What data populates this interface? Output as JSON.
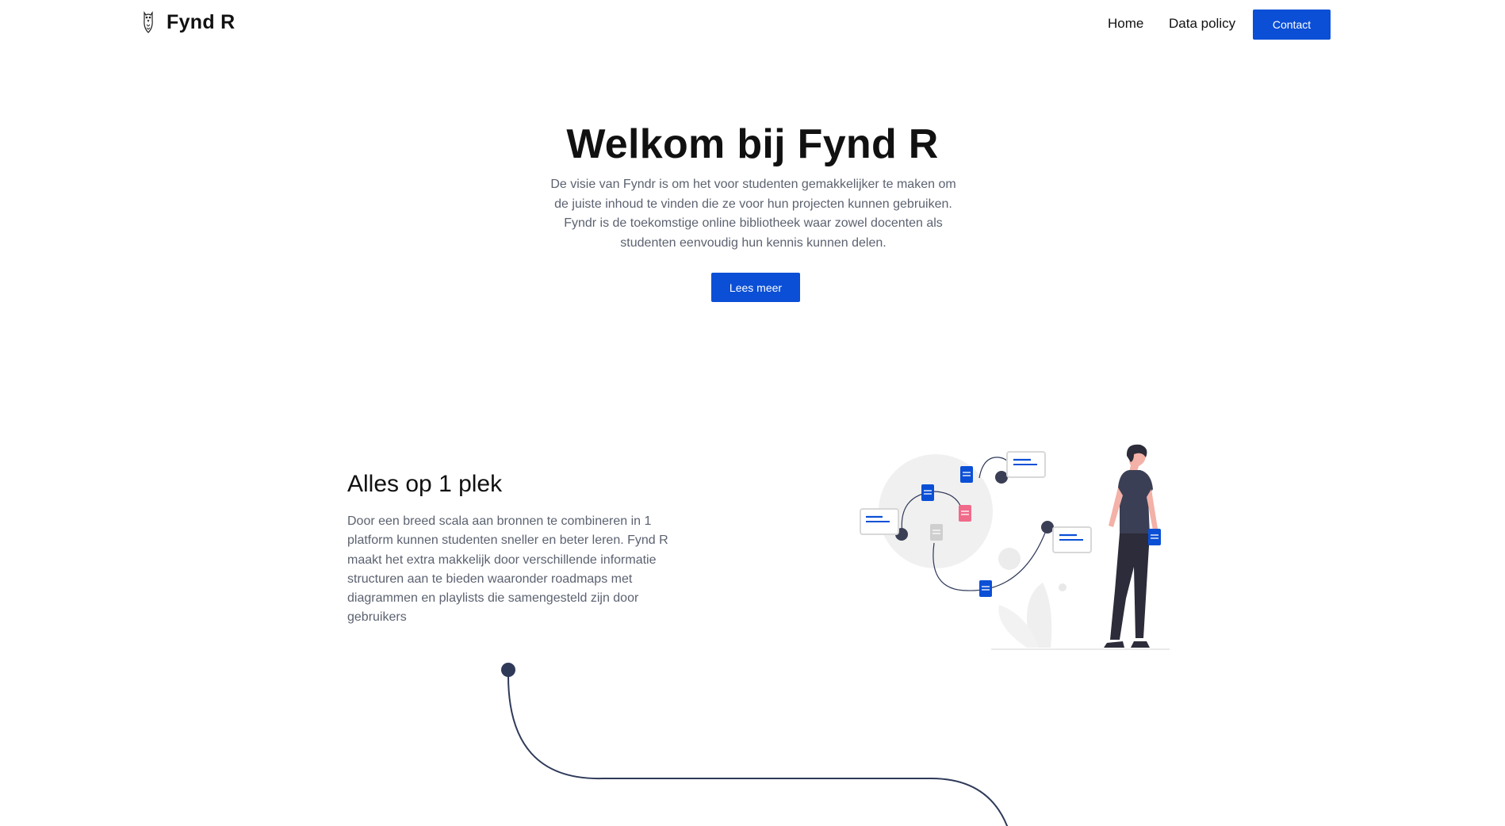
{
  "nav": {
    "brand": "Fynd R",
    "links": [
      "Home",
      "Data policy"
    ],
    "contact": "Contact"
  },
  "hero": {
    "title": "Welkom bij Fynd R",
    "text": "De visie van Fyndr is om het voor studenten gemakkelijker te maken om de juiste inhoud te vinden die ze voor hun projecten kunnen gebruiken. Fyndr is de toekomstige online bibliotheek waar zowel docenten als studenten eenvoudig hun kennis kunnen delen.",
    "button": "Lees meer"
  },
  "feature": {
    "title": "Alles op 1 plek",
    "text": "Door een breed scala aan bronnen te combineren in 1 platform kunnen studenten sneller en beter leren. Fynd R maakt het extra makkelijk door verschillende informatie structuren aan te bieden waaronder roadmaps met diagrammen en playlists die samengesteld zijn door gebruikers"
  },
  "colors": {
    "accent": "#0b4fd6",
    "dark": "#2f3a59",
    "pink": "#f06a8a"
  },
  "icons": [
    "owl-logo-icon",
    "document-icon"
  ]
}
